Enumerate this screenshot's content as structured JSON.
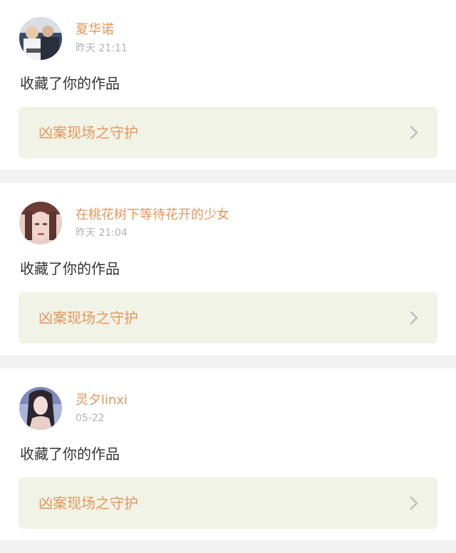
{
  "notifications": [
    {
      "username": "夏华诺",
      "time": "昨天 21:11",
      "action": "收藏了你的作品",
      "work_title": "凶案现场之守护"
    },
    {
      "username": "在桃花树下等待花开的少女",
      "time": "昨天 21:04",
      "action": "收藏了你的作品",
      "work_title": "凶案现场之守护"
    },
    {
      "username": "灵夕linxi",
      "time": "05-22",
      "action": "收藏了你的作品",
      "work_title": "凶案现场之守护"
    }
  ],
  "colors": {
    "accent": "#e8955a",
    "work_box_bg": "#f1f3e6",
    "separator": "#f2f2f2",
    "time_text": "#b3b3b3"
  },
  "icons": {
    "arrow": "chevron-right-icon"
  }
}
